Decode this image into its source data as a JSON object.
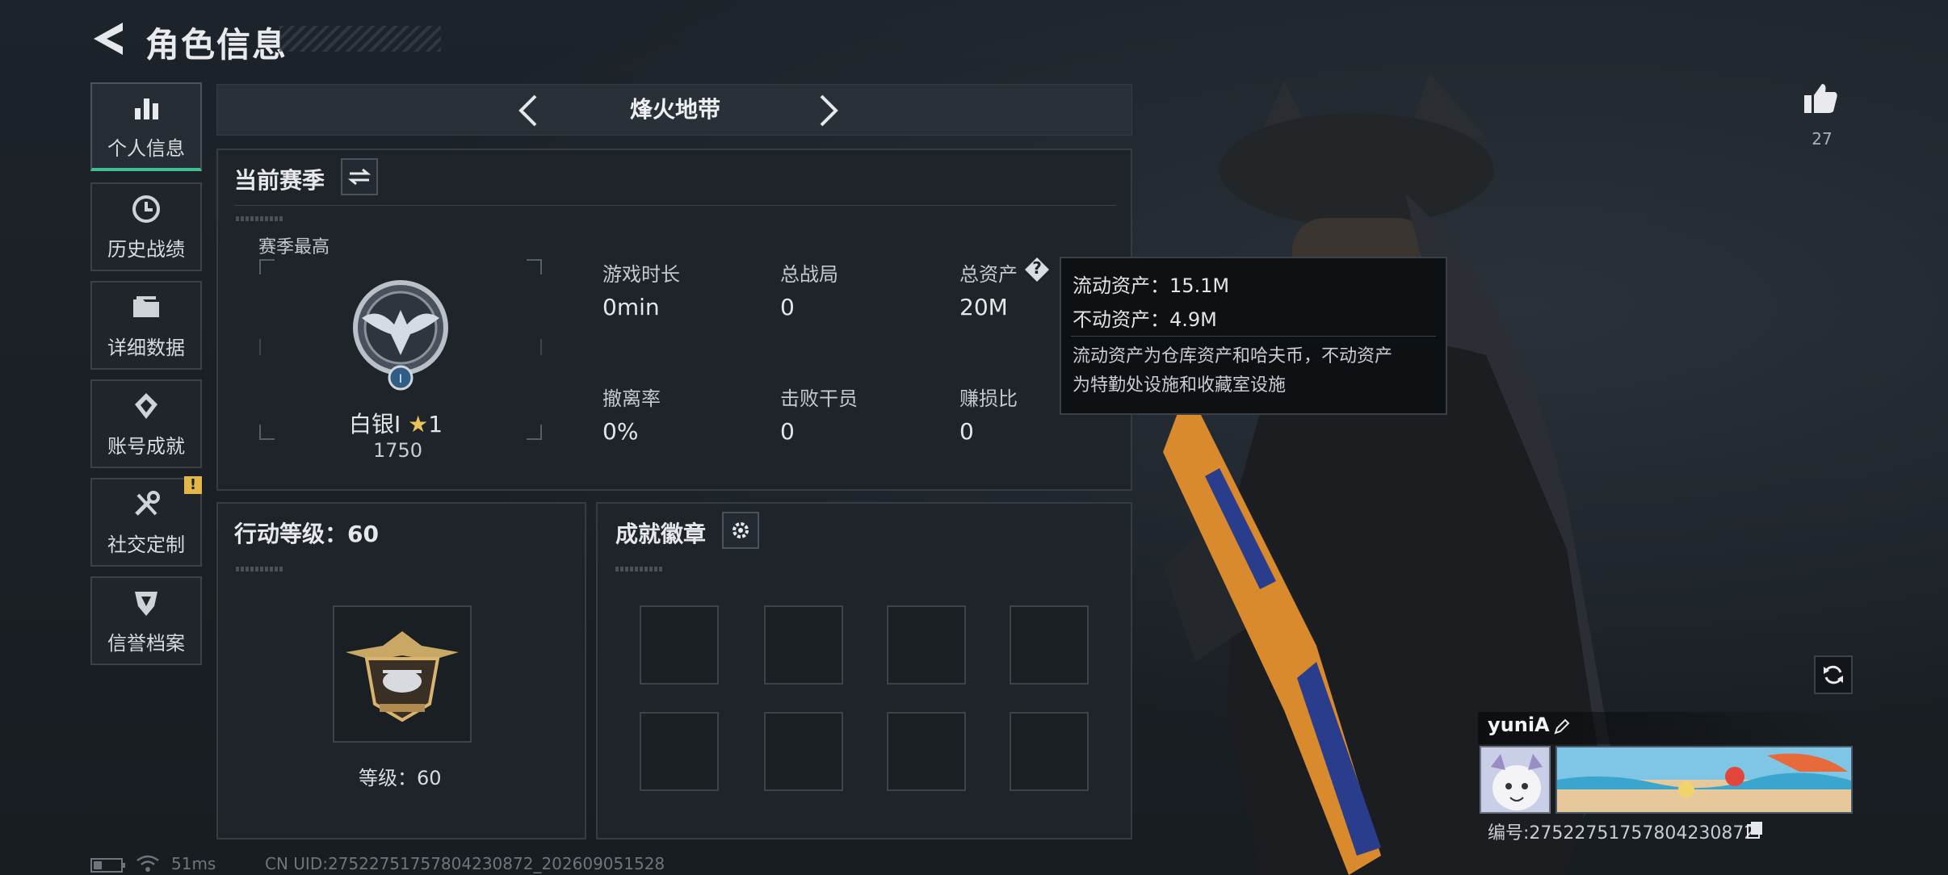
{
  "header": {
    "title": "角色信息"
  },
  "nav": {
    "items": [
      {
        "label": "个人信息",
        "active": true,
        "icon": "bar-chart-icon"
      },
      {
        "label": "历史战绩",
        "active": false,
        "icon": "clock-icon"
      },
      {
        "label": "详细数据",
        "active": false,
        "icon": "folder-icon"
      },
      {
        "label": "账号成就",
        "active": false,
        "icon": "diamond-badge-icon"
      },
      {
        "label": "社交定制",
        "active": false,
        "icon": "wrench-icon"
      },
      {
        "label": "信誉档案",
        "active": false,
        "icon": "shield-icon"
      }
    ],
    "warning_badge": "!"
  },
  "mode": {
    "name": "烽火地带"
  },
  "season": {
    "title": "当前赛季",
    "best_label": "赛季最高",
    "rank_name": "白银I",
    "rank_star": "★",
    "rank_stars": "1",
    "rank_score": "1750",
    "stats": [
      {
        "label": "游戏时长",
        "value": "0min"
      },
      {
        "label": "总战局",
        "value": "0"
      },
      {
        "label": "总资产",
        "value": "20M"
      },
      {
        "label": "撤离率",
        "value": "0%"
      },
      {
        "label": "击败干员",
        "value": "0"
      },
      {
        "label": "赚损比",
        "value": "0"
      }
    ],
    "help_icon": "?"
  },
  "tooltip": {
    "liquid": "流动资产：15.1M",
    "fixed": "不动资产：4.9M",
    "desc_line1": "流动资产为仓库资产和哈夫币，不动资产",
    "desc_line2": "为特勤处设施和收藏室设施"
  },
  "action_level": {
    "title": "行动等级：60",
    "level_text": "等级：60"
  },
  "achievements": {
    "title": "成就徽章",
    "slot_count": 8
  },
  "profile": {
    "likes": "27",
    "name": "yuniA",
    "id_text": "编号:2752275175780423087​2"
  },
  "status": {
    "ping": "51ms",
    "uid": "CN UID:2752275175780423087​2_202609051528"
  },
  "colors": {
    "accent": "#3fbf8f",
    "warning": "#e3b64a",
    "background": "#1b2026",
    "panel": "#1e242a"
  }
}
